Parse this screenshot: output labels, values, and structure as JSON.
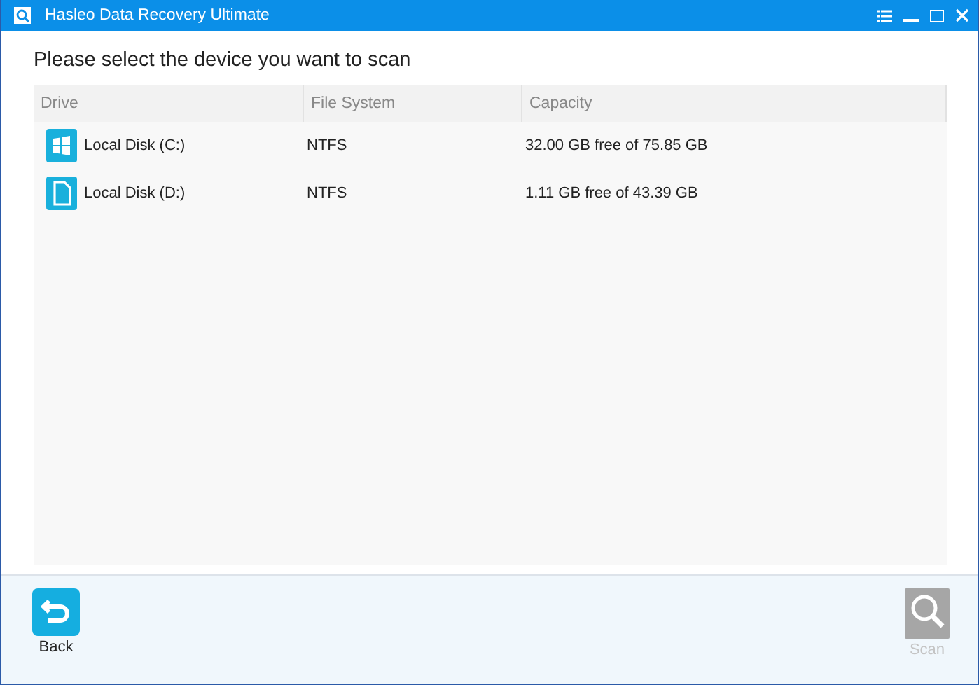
{
  "window": {
    "title": "Hasleo Data Recovery Ultimate"
  },
  "heading": "Please select the device you want to scan",
  "table": {
    "columns": [
      "Drive",
      "File System",
      "Capacity"
    ],
    "rows": [
      {
        "kind": "system",
        "drive": "Local Disk (C:)",
        "file_system": "NTFS",
        "capacity": "32.00 GB free of 75.85 GB"
      },
      {
        "kind": "data",
        "drive": "Local Disk (D:)",
        "file_system": "NTFS",
        "capacity": "1.11 GB free of 43.39 GB"
      }
    ]
  },
  "buttons": [
    {
      "kind": "back",
      "label": "Back",
      "disabled": false
    },
    {
      "kind": "scan",
      "label": "Scan",
      "disabled": true
    }
  ]
}
